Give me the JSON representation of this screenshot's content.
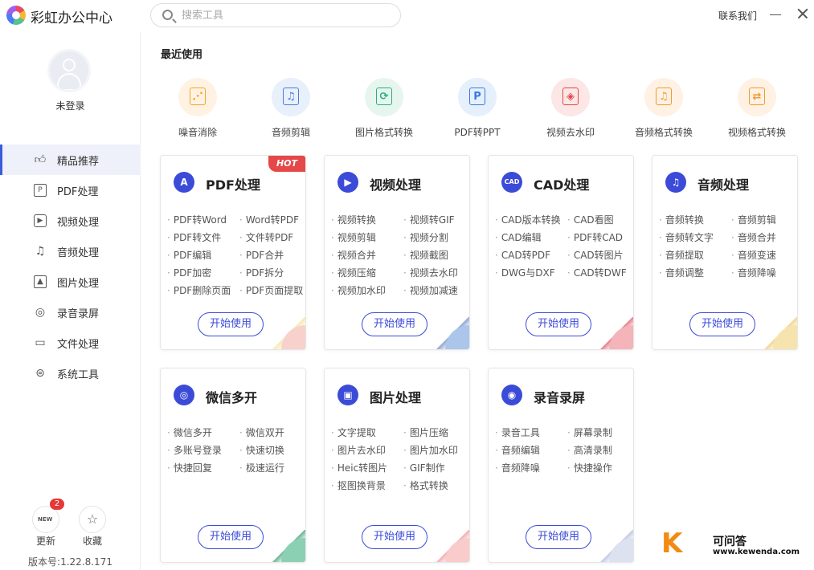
{
  "app": {
    "title": "彩虹办公中心",
    "contact": "联系我们"
  },
  "search": {
    "placeholder": "搜索工具"
  },
  "user": {
    "login_text": "未登录"
  },
  "sidebar": {
    "items": [
      {
        "label": "精品推荐",
        "icon": "thumbs-up-icon",
        "active": true
      },
      {
        "label": "PDF处理",
        "icon": "pdf-icon"
      },
      {
        "label": "视频处理",
        "icon": "video-icon"
      },
      {
        "label": "音频处理",
        "icon": "music-icon"
      },
      {
        "label": "图片处理",
        "icon": "image-icon"
      },
      {
        "label": "录音录屏",
        "icon": "record-icon"
      },
      {
        "label": "文件处理",
        "icon": "folder-icon"
      },
      {
        "label": "系统工具",
        "icon": "system-icon"
      }
    ],
    "update_label": "更新",
    "update_badge": "2",
    "update_icon_text": "NEW",
    "favorite_label": "收藏",
    "version": "版本号:1.22.8.171"
  },
  "recent": {
    "title": "最近使用",
    "items": [
      {
        "label": "噪音消除",
        "icon": "noise-cancel-icon",
        "bg": "#fff2e3",
        "fg": "#f5a623",
        "glyph": "⋰"
      },
      {
        "label": "音频剪辑",
        "icon": "audio-cut-icon",
        "bg": "#e8f0fc",
        "fg": "#4a7bd8",
        "glyph": "♫"
      },
      {
        "label": "图片格式转换",
        "icon": "image-convert-icon",
        "bg": "#e6f6ef",
        "fg": "#2bb07a",
        "glyph": "⟳"
      },
      {
        "label": "PDF转PPT",
        "icon": "pdf-to-ppt-icon",
        "bg": "#e6f0fd",
        "fg": "#3a78e0",
        "glyph": "P"
      },
      {
        "label": "视频去水印",
        "icon": "video-watermark-icon",
        "bg": "#fde6e6",
        "fg": "#e04848",
        "glyph": "◈"
      },
      {
        "label": "音频格式转换",
        "icon": "audio-convert-icon",
        "bg": "#fff1e3",
        "fg": "#f29a2e",
        "glyph": "♫"
      },
      {
        "label": "视频格式转换",
        "icon": "video-convert-icon",
        "bg": "#fff1e3",
        "fg": "#f29a2e",
        "glyph": "⇄"
      }
    ]
  },
  "cards": [
    {
      "title": "PDF处理",
      "icon": "pdf-logo-icon",
      "color": "#3b4bd8",
      "glyph": "A",
      "hot": "HOT",
      "features": [
        "PDF转Word",
        "Word转PDF",
        "PDF转文件",
        "文件转PDF",
        "PDF编辑",
        "PDF合并",
        "PDF加密",
        "PDF拆分",
        "PDF删除页面",
        "PDF页面提取"
      ],
      "button": "开始使用"
    },
    {
      "title": "视频处理",
      "icon": "video-play-icon",
      "color": "#3b4bd8",
      "glyph": "▶",
      "features": [
        "视频转换",
        "视频转GIF",
        "视频剪辑",
        "视频分割",
        "视频合并",
        "视频截图",
        "视频压缩",
        "视频去水印",
        "视频加水印",
        "视频加减速"
      ],
      "button": "开始使用"
    },
    {
      "title": "CAD处理",
      "icon": "cad-icon",
      "color": "#3b4bd8",
      "glyph": "CAD",
      "features": [
        "CAD版本转换",
        "CAD看图",
        "CAD编辑",
        "PDF转CAD",
        "CAD转PDF",
        "CAD转图片",
        "DWG与DXF",
        "CAD转DWF"
      ],
      "button": "开始使用"
    },
    {
      "title": "音频处理",
      "icon": "music-note-icon",
      "color": "#3b4bd8",
      "glyph": "♫",
      "features": [
        "音频转换",
        "音频剪辑",
        "音频转文字",
        "音频合并",
        "音频提取",
        "音频变速",
        "音频调整",
        "音频降噪"
      ],
      "button": "开始使用"
    },
    {
      "title": "微信多开",
      "icon": "wechat-icon",
      "color": "#3b4bd8",
      "glyph": "◎",
      "features": [
        "微信多开",
        "微信双开",
        "多账号登录",
        "快速切换",
        "快捷回复",
        "极速运行"
      ],
      "button": "开始使用"
    },
    {
      "title": "图片处理",
      "icon": "picture-icon",
      "color": "#3b4bd8",
      "glyph": "▣",
      "features": [
        "文字提取",
        "图片压缩",
        "图片去水印",
        "图片加水印",
        "Heic转图片",
        "GIF制作",
        "抠图换背景",
        "格式转换"
      ],
      "button": "开始使用"
    },
    {
      "title": "录音录屏",
      "icon": "microphone-icon",
      "color": "#3b4bd8",
      "glyph": "◉",
      "features": [
        "录音工具",
        "屏幕录制",
        "音频编辑",
        "高清录制",
        "音频降噪",
        "快捷操作"
      ],
      "button": "开始使用"
    }
  ],
  "watermark": {
    "mark": "K",
    "name": "可问答",
    "url": "www.kewenda.com"
  }
}
